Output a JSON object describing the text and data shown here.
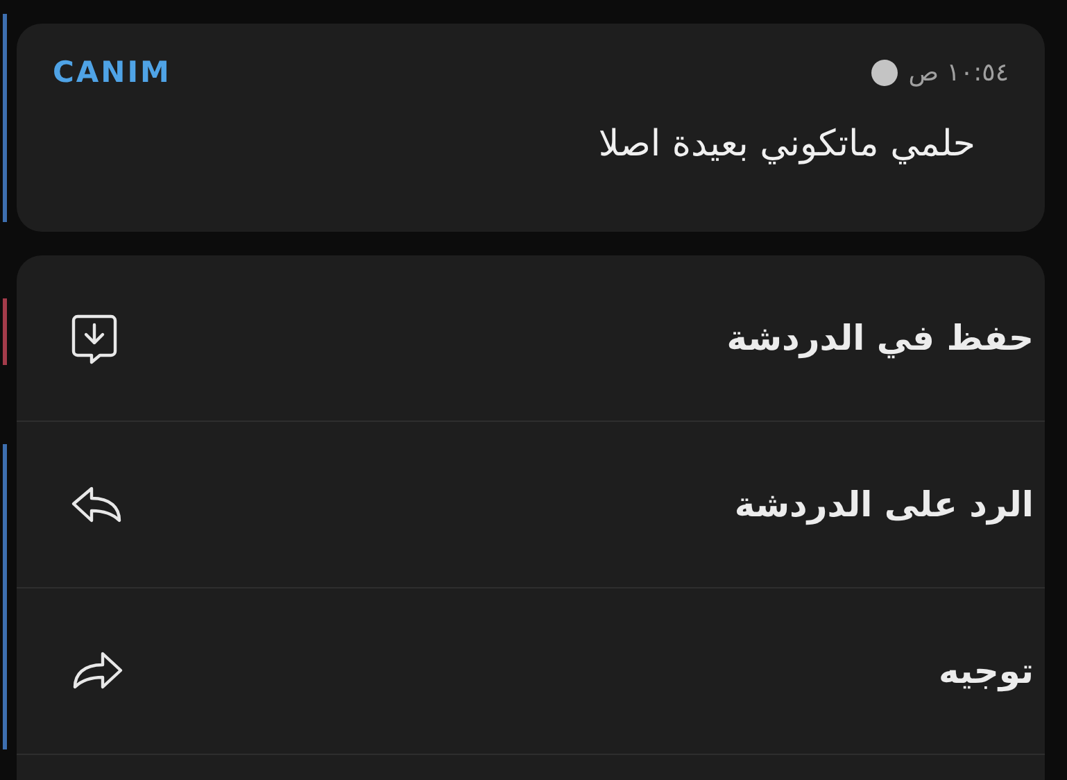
{
  "message": {
    "sender": "CANIM",
    "time": "١٠:٥٤ ص",
    "text": "حلمي ماتكوني بعيدة اصلا"
  },
  "menu": [
    {
      "kind": "save",
      "label": "حفظ في الدردشة"
    },
    {
      "kind": "reply",
      "label": "الرد على الدردشة"
    },
    {
      "kind": "forward",
      "label": "توجيه"
    }
  ]
}
